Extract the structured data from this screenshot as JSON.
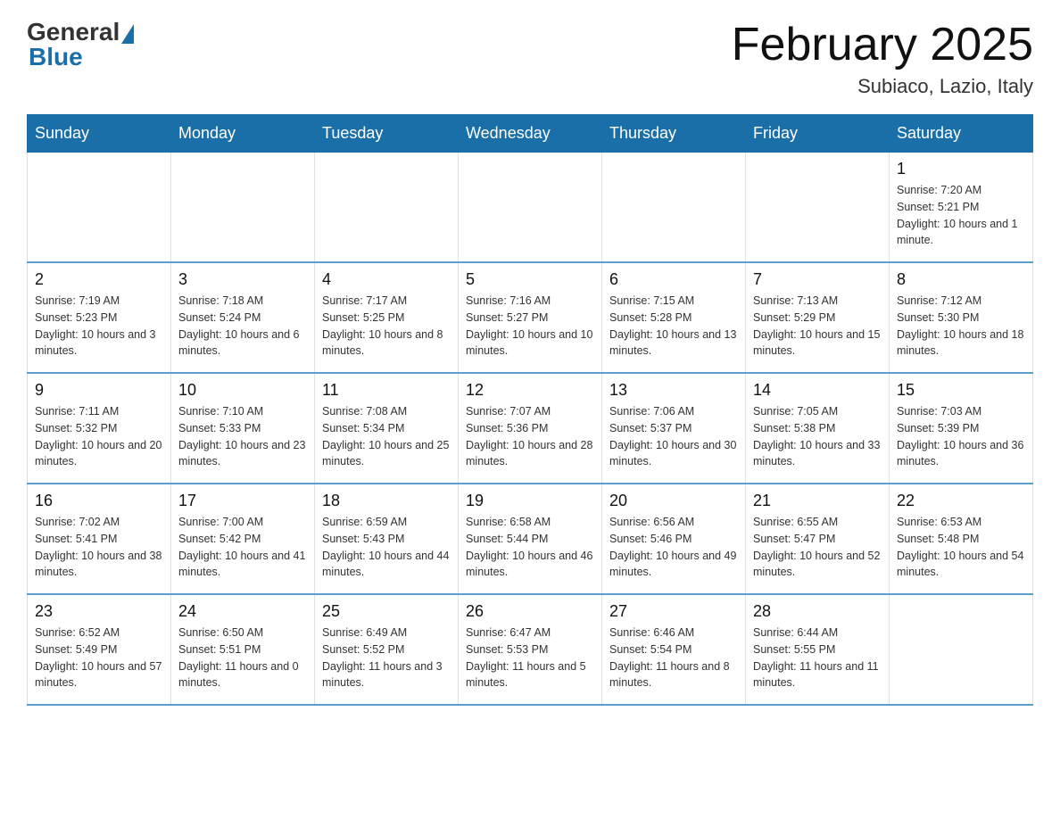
{
  "header": {
    "logo_general": "General",
    "logo_blue": "Blue",
    "title": "February 2025",
    "subtitle": "Subiaco, Lazio, Italy"
  },
  "days_of_week": [
    "Sunday",
    "Monday",
    "Tuesday",
    "Wednesday",
    "Thursday",
    "Friday",
    "Saturday"
  ],
  "weeks": [
    [
      {
        "day": "",
        "info": ""
      },
      {
        "day": "",
        "info": ""
      },
      {
        "day": "",
        "info": ""
      },
      {
        "day": "",
        "info": ""
      },
      {
        "day": "",
        "info": ""
      },
      {
        "day": "",
        "info": ""
      },
      {
        "day": "1",
        "info": "Sunrise: 7:20 AM\nSunset: 5:21 PM\nDaylight: 10 hours and 1 minute."
      }
    ],
    [
      {
        "day": "2",
        "info": "Sunrise: 7:19 AM\nSunset: 5:23 PM\nDaylight: 10 hours and 3 minutes."
      },
      {
        "day": "3",
        "info": "Sunrise: 7:18 AM\nSunset: 5:24 PM\nDaylight: 10 hours and 6 minutes."
      },
      {
        "day": "4",
        "info": "Sunrise: 7:17 AM\nSunset: 5:25 PM\nDaylight: 10 hours and 8 minutes."
      },
      {
        "day": "5",
        "info": "Sunrise: 7:16 AM\nSunset: 5:27 PM\nDaylight: 10 hours and 10 minutes."
      },
      {
        "day": "6",
        "info": "Sunrise: 7:15 AM\nSunset: 5:28 PM\nDaylight: 10 hours and 13 minutes."
      },
      {
        "day": "7",
        "info": "Sunrise: 7:13 AM\nSunset: 5:29 PM\nDaylight: 10 hours and 15 minutes."
      },
      {
        "day": "8",
        "info": "Sunrise: 7:12 AM\nSunset: 5:30 PM\nDaylight: 10 hours and 18 minutes."
      }
    ],
    [
      {
        "day": "9",
        "info": "Sunrise: 7:11 AM\nSunset: 5:32 PM\nDaylight: 10 hours and 20 minutes."
      },
      {
        "day": "10",
        "info": "Sunrise: 7:10 AM\nSunset: 5:33 PM\nDaylight: 10 hours and 23 minutes."
      },
      {
        "day": "11",
        "info": "Sunrise: 7:08 AM\nSunset: 5:34 PM\nDaylight: 10 hours and 25 minutes."
      },
      {
        "day": "12",
        "info": "Sunrise: 7:07 AM\nSunset: 5:36 PM\nDaylight: 10 hours and 28 minutes."
      },
      {
        "day": "13",
        "info": "Sunrise: 7:06 AM\nSunset: 5:37 PM\nDaylight: 10 hours and 30 minutes."
      },
      {
        "day": "14",
        "info": "Sunrise: 7:05 AM\nSunset: 5:38 PM\nDaylight: 10 hours and 33 minutes."
      },
      {
        "day": "15",
        "info": "Sunrise: 7:03 AM\nSunset: 5:39 PM\nDaylight: 10 hours and 36 minutes."
      }
    ],
    [
      {
        "day": "16",
        "info": "Sunrise: 7:02 AM\nSunset: 5:41 PM\nDaylight: 10 hours and 38 minutes."
      },
      {
        "day": "17",
        "info": "Sunrise: 7:00 AM\nSunset: 5:42 PM\nDaylight: 10 hours and 41 minutes."
      },
      {
        "day": "18",
        "info": "Sunrise: 6:59 AM\nSunset: 5:43 PM\nDaylight: 10 hours and 44 minutes."
      },
      {
        "day": "19",
        "info": "Sunrise: 6:58 AM\nSunset: 5:44 PM\nDaylight: 10 hours and 46 minutes."
      },
      {
        "day": "20",
        "info": "Sunrise: 6:56 AM\nSunset: 5:46 PM\nDaylight: 10 hours and 49 minutes."
      },
      {
        "day": "21",
        "info": "Sunrise: 6:55 AM\nSunset: 5:47 PM\nDaylight: 10 hours and 52 minutes."
      },
      {
        "day": "22",
        "info": "Sunrise: 6:53 AM\nSunset: 5:48 PM\nDaylight: 10 hours and 54 minutes."
      }
    ],
    [
      {
        "day": "23",
        "info": "Sunrise: 6:52 AM\nSunset: 5:49 PM\nDaylight: 10 hours and 57 minutes."
      },
      {
        "day": "24",
        "info": "Sunrise: 6:50 AM\nSunset: 5:51 PM\nDaylight: 11 hours and 0 minutes."
      },
      {
        "day": "25",
        "info": "Sunrise: 6:49 AM\nSunset: 5:52 PM\nDaylight: 11 hours and 3 minutes."
      },
      {
        "day": "26",
        "info": "Sunrise: 6:47 AM\nSunset: 5:53 PM\nDaylight: 11 hours and 5 minutes."
      },
      {
        "day": "27",
        "info": "Sunrise: 6:46 AM\nSunset: 5:54 PM\nDaylight: 11 hours and 8 minutes."
      },
      {
        "day": "28",
        "info": "Sunrise: 6:44 AM\nSunset: 5:55 PM\nDaylight: 11 hours and 11 minutes."
      },
      {
        "day": "",
        "info": ""
      }
    ]
  ]
}
